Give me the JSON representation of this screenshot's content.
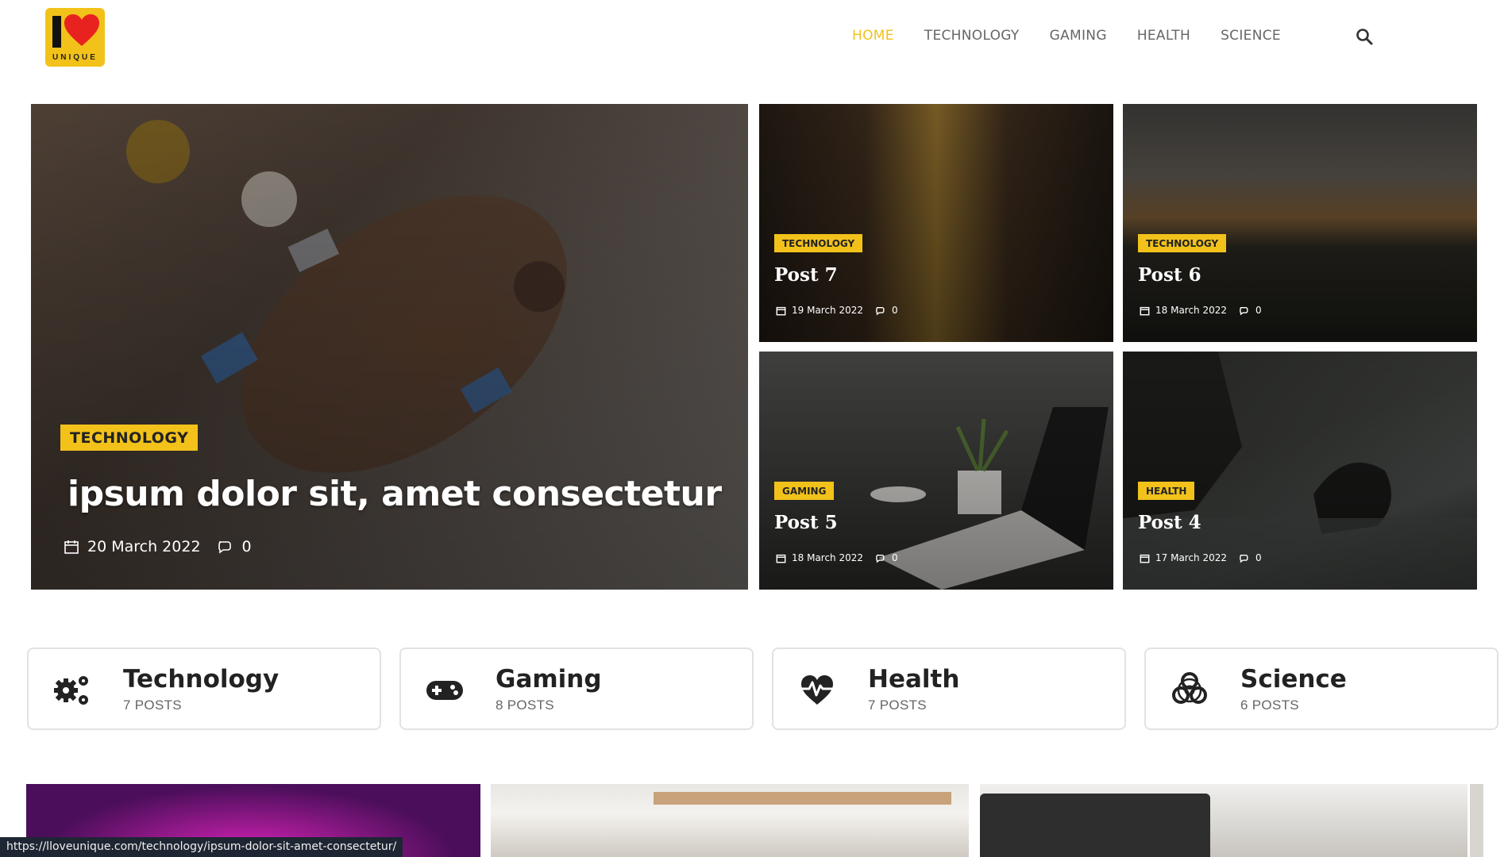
{
  "header": {
    "logo_text": "UNIQUE",
    "nav": [
      {
        "label": "HOME",
        "active": true
      },
      {
        "label": "TECHNOLOGY",
        "active": false
      },
      {
        "label": "GAMING",
        "active": false
      },
      {
        "label": "HEALTH",
        "active": false
      },
      {
        "label": "SCIENCE",
        "active": false
      }
    ]
  },
  "featured": {
    "category": "TECHNOLOGY",
    "title": "ipsum dolor sit, amet consectetur",
    "date": "20 March 2022",
    "comments": "0"
  },
  "posts": [
    {
      "category": "TECHNOLOGY",
      "title": "Post 7",
      "date": "19 March 2022",
      "comments": "0"
    },
    {
      "category": "TECHNOLOGY",
      "title": "Post 6",
      "date": "18 March 2022",
      "comments": "0"
    },
    {
      "category": "GAMING",
      "title": "Post 5",
      "date": "18 March 2022",
      "comments": "0"
    },
    {
      "category": "HEALTH",
      "title": "Post 4",
      "date": "17 March 2022",
      "comments": "0"
    }
  ],
  "categories": [
    {
      "name": "Technology",
      "count": "7 POSTS",
      "icon": "gears-icon"
    },
    {
      "name": "Gaming",
      "count": "8 POSTS",
      "icon": "gamepad-icon"
    },
    {
      "name": "Health",
      "count": "7 POSTS",
      "icon": "heartbeat-icon"
    },
    {
      "name": "Science",
      "count": "6 POSTS",
      "icon": "biohazard-icon"
    }
  ],
  "status_url": "https://lloveunique.com/technology/ipsum-dolor-sit-amet-consectetur/",
  "colors": {
    "accent": "#f2c21b",
    "nav_text": "#666666",
    "status_bg": "#1f2633"
  }
}
